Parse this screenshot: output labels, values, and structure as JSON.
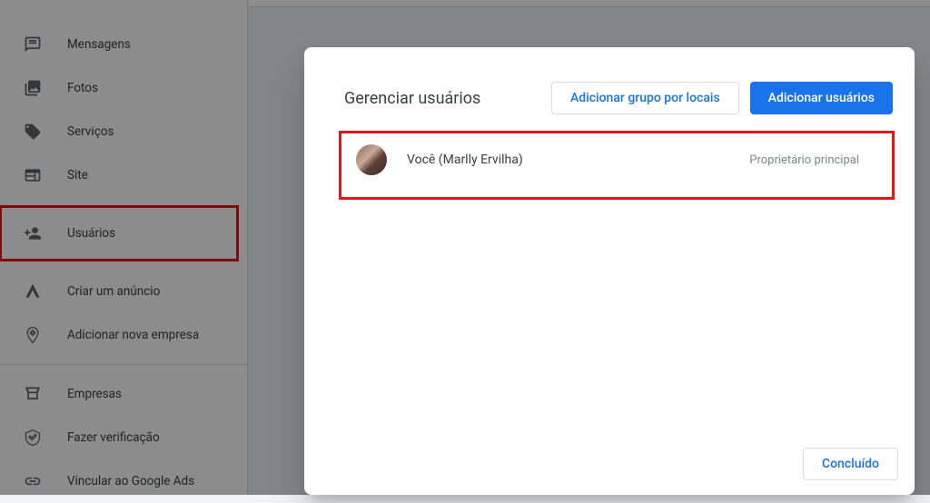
{
  "sidebar": {
    "items": [
      {
        "label": "Mensagens"
      },
      {
        "label": "Fotos"
      },
      {
        "label": "Serviços"
      },
      {
        "label": "Site"
      },
      {
        "label": "Usuários"
      },
      {
        "label": "Criar um anúncio"
      },
      {
        "label": "Adicionar nova empresa"
      },
      {
        "label": "Empresas"
      },
      {
        "label": "Fazer verificação"
      },
      {
        "label": "Vincular ao Google Ads"
      }
    ]
  },
  "modal": {
    "title": "Gerenciar usuários",
    "add_group_button": "Adicionar grupo por locais",
    "add_users_button": "Adicionar usuários",
    "done_button": "Concluído",
    "users": [
      {
        "name": "Você (Marlly Ervilha)",
        "role": "Proprietário principal"
      }
    ]
  }
}
